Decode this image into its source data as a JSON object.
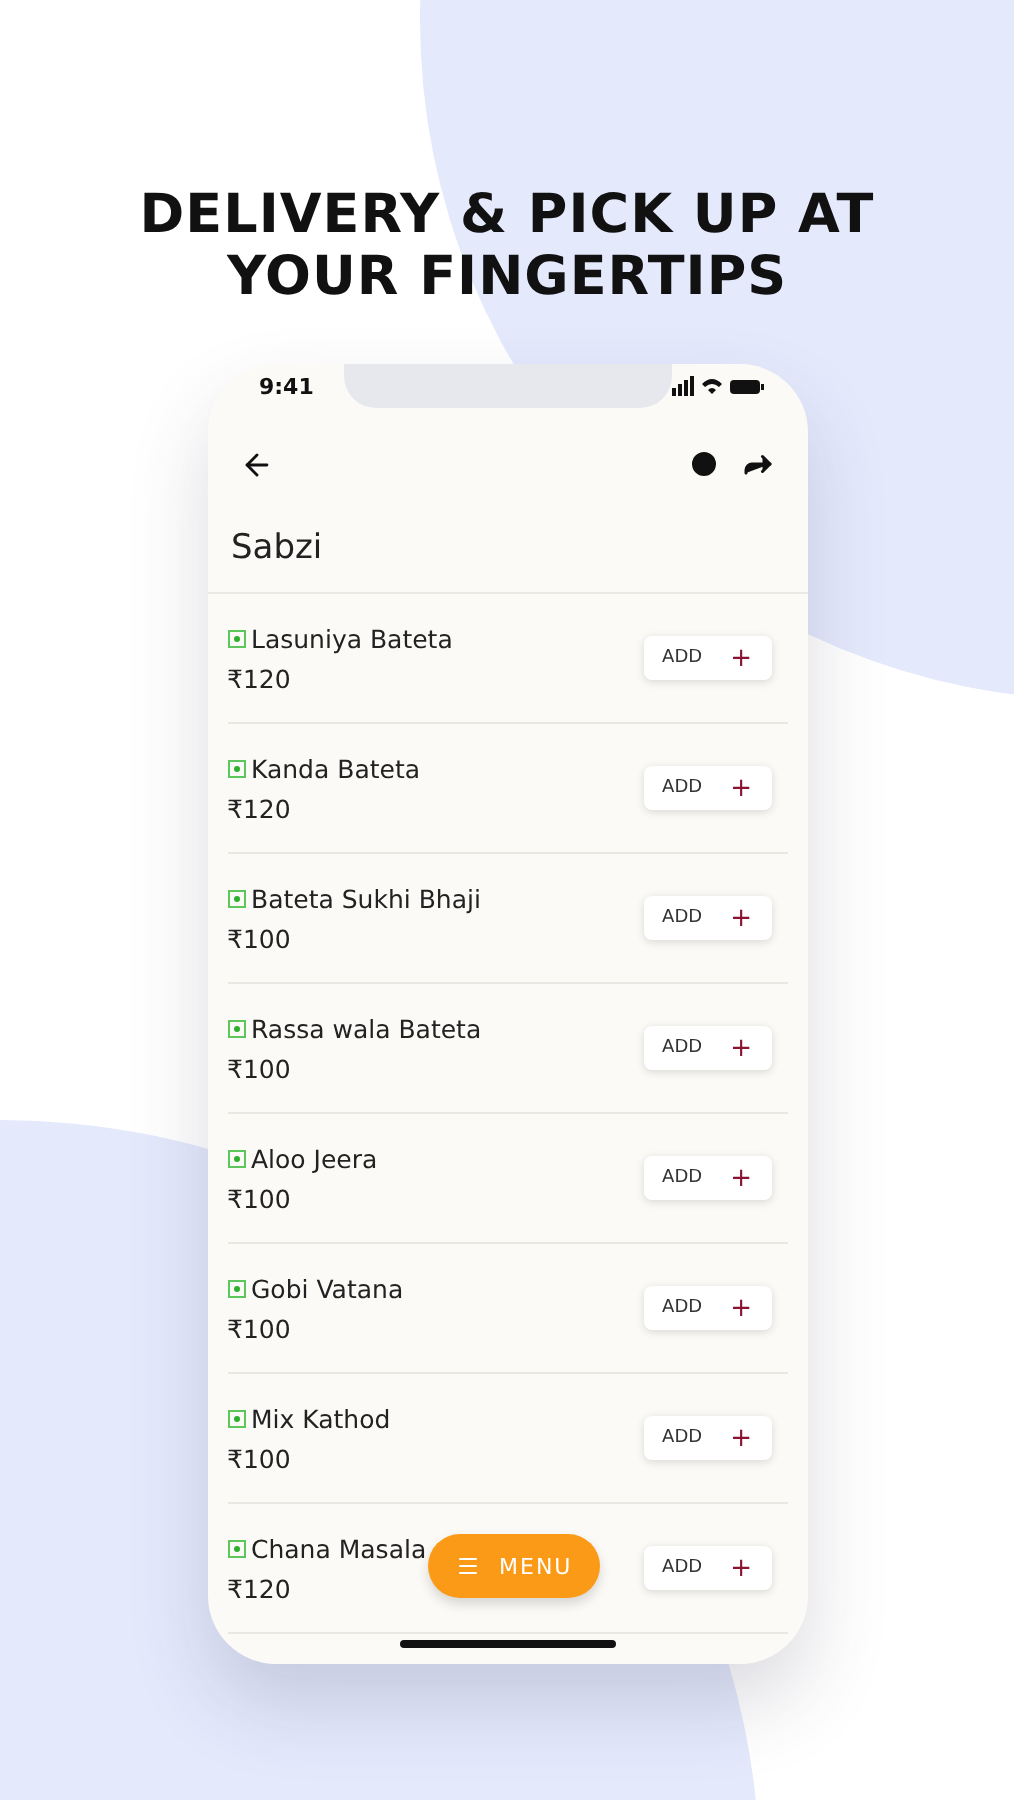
{
  "headline": [
    "DELIVERY & PICK UP AT",
    "YOUR FINGERTIPS"
  ],
  "status_bar": {
    "time": "9:41"
  },
  "page_title": "Sabzi",
  "items": [
    {
      "name": "Lasuniya Bateta",
      "price": "₹120",
      "button": "ADD",
      "button_icon": "+"
    },
    {
      "name": "Kanda Bateta",
      "price": "₹120",
      "button": "ADD",
      "button_icon": "+"
    },
    {
      "name": "Bateta Sukhi Bhaji",
      "price": "₹100",
      "button": "ADD",
      "button_icon": "+"
    },
    {
      "name": "Rassa wala Bateta",
      "price": "₹100",
      "button": "ADD",
      "button_icon": "+"
    },
    {
      "name": "Aloo Jeera",
      "price": "₹100",
      "button": "ADD",
      "button_icon": "+"
    },
    {
      "name": "Gobi Vatana",
      "price": "₹100",
      "button": "ADD",
      "button_icon": "+"
    },
    {
      "name": "Mix Kathod",
      "price": "₹100",
      "button": "ADD",
      "button_icon": "+"
    },
    {
      "name": "Chana Masala",
      "price": "₹120",
      "button": "ADD",
      "button_icon": "+"
    }
  ],
  "menu_button": {
    "label": "MENU"
  }
}
